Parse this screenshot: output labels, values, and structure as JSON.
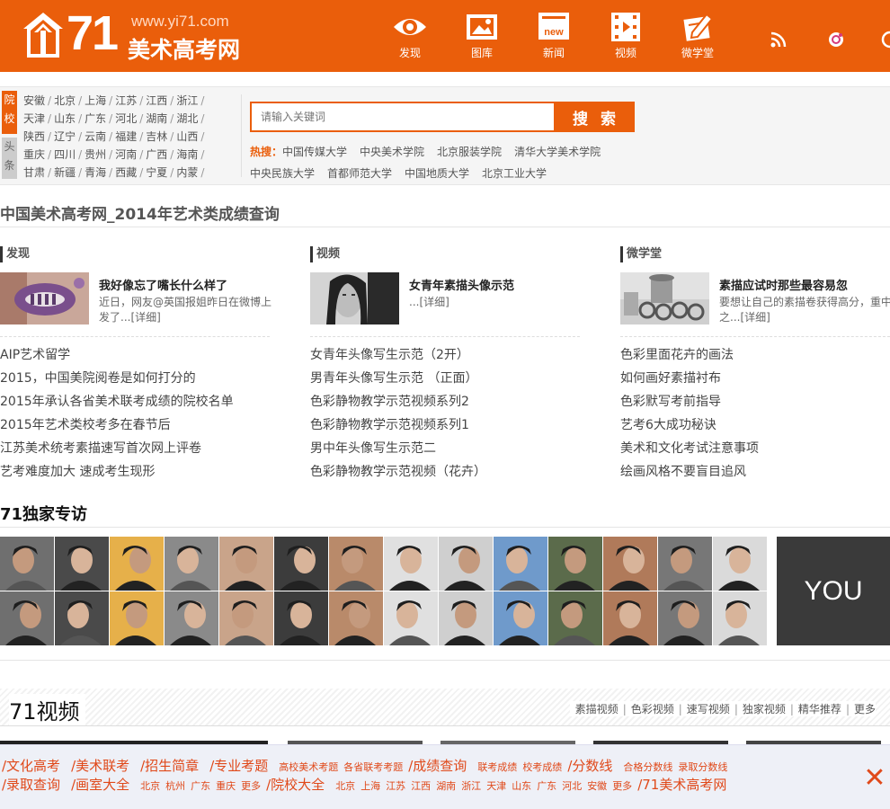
{
  "header": {
    "logo_num": "71",
    "logo_url": "www.yi71.com",
    "logo_name": "美术高考网",
    "nav": [
      {
        "label": "发现",
        "icon": "eye-icon"
      },
      {
        "label": "图库",
        "icon": "image-icon"
      },
      {
        "label": "新闻",
        "icon": "news-icon",
        "badge": "new"
      },
      {
        "label": "视频",
        "icon": "film-icon"
      },
      {
        "label": "微学堂",
        "icon": "pencil-paper-icon"
      }
    ]
  },
  "search": {
    "tab1": "院校",
    "tab2": "头条",
    "regions": [
      [
        "安徽",
        "北京",
        "上海",
        "江苏",
        "江西",
        "浙江"
      ],
      [
        "天津",
        "山东",
        "广东",
        "河北",
        "湖南",
        "湖北"
      ],
      [
        "陕西",
        "辽宁",
        "云南",
        "福建",
        "吉林",
        "山西"
      ],
      [
        "重庆",
        "四川",
        "贵州",
        "河南",
        "广西",
        "海南"
      ],
      [
        "甘肃",
        "新疆",
        "青海",
        "西藏",
        "宁夏",
        "内蒙"
      ]
    ],
    "placeholder": "请输入关键词",
    "button": "搜索",
    "hot_label": "热搜：",
    "hot": [
      "中国传媒大学",
      "中央美术学院",
      "北京服装学院",
      "清华大学美术学院",
      "中央民族大学",
      "首都师范大学",
      "中国地质大学",
      "北京工业大学"
    ]
  },
  "page_title": "中国美术高考网_2014年艺术类成绩查询",
  "columns": [
    {
      "head": "发现",
      "feature_title": "我好像忘了嘴长什么样了",
      "feature_desc": "近日，网友@英国报姐昨日在微博上发了...[详细]",
      "items": [
        "AIP艺术留学",
        "2015，中国美院阅卷是如何打分的",
        "2015年承认各省美术联考成绩的院校名单",
        "2015年艺术类校考多在春节后",
        "江苏美术统考素描速写首次网上评卷",
        "艺考难度加大 速成考生现形"
      ]
    },
    {
      "head": "视频",
      "feature_title": "女青年素描头像示范",
      "feature_desc": "...[详细]",
      "items": [
        "女青年头像写生示范（2开）",
        "男青年头像写生示范 （正面）",
        "色彩静物教学示范视频系列2",
        "色彩静物教学示范视频系列1",
        "男中年头像写生示范二",
        "色彩静物教学示范视频（花卉）"
      ]
    },
    {
      "head": "微学堂",
      "feature_title": "素描应试时那些最容易忽",
      "feature_desc": "要想让自己的素描卷获得高分，重中之...[详细]",
      "items": [
        "色彩里面花卉的画法",
        "如何画好素描衬布",
        "色彩默写考前指导",
        "艺考6大成功秘诀",
        "美术和文化考试注意事项",
        "绘画风格不要盲目追风"
      ]
    }
  ],
  "interview": {
    "title": "71独家专访",
    "you": "YOU"
  },
  "video": {
    "title": "71视频",
    "links": [
      "素描视频",
      "色彩视频",
      "速写视频",
      "独家视频",
      "精华推荐",
      "更多"
    ]
  },
  "bottom": {
    "row1": [
      {
        "t": "/文化高考",
        "s": "big"
      },
      {
        "t": "/美术联考",
        "s": "big"
      },
      {
        "t": "/招生简章",
        "s": "big"
      },
      {
        "t": "/专业考题",
        "s": "big"
      },
      {
        "t": "高校美术考题",
        "s": "sm"
      },
      {
        "t": "各省联考考题",
        "s": "sm"
      },
      {
        "t": "/成绩查询",
        "s": "big"
      },
      {
        "t": "联考成绩",
        "s": "sm"
      },
      {
        "t": "校考成绩",
        "s": "sm"
      },
      {
        "t": "/分数线",
        "s": "big"
      },
      {
        "t": "合格分数线",
        "s": "sm"
      },
      {
        "t": "录取分数线",
        "s": "sm"
      }
    ],
    "row2": [
      {
        "t": "/录取查询",
        "s": "big"
      },
      {
        "t": "/画室大全",
        "s": "big"
      },
      {
        "t": "北京",
        "s": "sm"
      },
      {
        "t": "杭州",
        "s": "sm"
      },
      {
        "t": "广东",
        "s": "sm"
      },
      {
        "t": "重庆",
        "s": "sm"
      },
      {
        "t": "更多",
        "s": "sm"
      },
      {
        "t": "/院校大全",
        "s": "big"
      },
      {
        "t": "北京",
        "s": "sm"
      },
      {
        "t": "上海",
        "s": "sm"
      },
      {
        "t": "江苏",
        "s": "sm"
      },
      {
        "t": "江西",
        "s": "sm"
      },
      {
        "t": "湖南",
        "s": "sm"
      },
      {
        "t": "浙江",
        "s": "sm"
      },
      {
        "t": "天津",
        "s": "sm"
      },
      {
        "t": "山东",
        "s": "sm"
      },
      {
        "t": "广东",
        "s": "sm"
      },
      {
        "t": "河北",
        "s": "sm"
      },
      {
        "t": "安徽",
        "s": "sm"
      },
      {
        "t": "更多",
        "s": "sm"
      },
      {
        "t": "/71美术高考网",
        "s": "big"
      }
    ],
    "close": "✕"
  },
  "colors": {
    "brand": "#ea5e0b",
    "bottom_link": "#e0491a"
  }
}
